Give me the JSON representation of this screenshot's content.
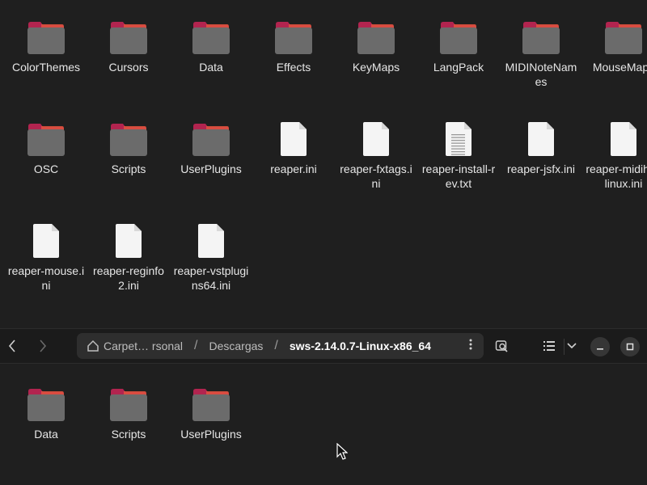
{
  "top_items": [
    {
      "type": "folder",
      "label": "ColorThemes"
    },
    {
      "type": "folder",
      "label": "Cursors"
    },
    {
      "type": "folder",
      "label": "Data"
    },
    {
      "type": "folder",
      "label": "Effects"
    },
    {
      "type": "folder",
      "label": "KeyMaps"
    },
    {
      "type": "folder",
      "label": "LangPack"
    },
    {
      "type": "folder",
      "label": "MIDINoteNames"
    },
    {
      "type": "folder",
      "label": "MouseMaps"
    },
    {
      "type": "folder",
      "label": "OSC"
    },
    {
      "type": "folder",
      "label": "Scripts"
    },
    {
      "type": "folder",
      "label": "UserPlugins"
    },
    {
      "type": "file",
      "label": "reaper.ini"
    },
    {
      "type": "file",
      "label": "reaper-fxtags.ini"
    },
    {
      "type": "text-file",
      "label": "reaper-install-rev.txt"
    },
    {
      "type": "file",
      "label": "reaper-jsfx.ini"
    },
    {
      "type": "file",
      "label": "reaper-midihw-linux.ini"
    },
    {
      "type": "file",
      "label": "reaper-mouse.ini"
    },
    {
      "type": "file",
      "label": "reaper-reginfo2.ini"
    },
    {
      "type": "file",
      "label": "reaper-vstplugins64.ini"
    }
  ],
  "header": {
    "back_icon": "chevron-left-icon",
    "forward_icon": "chevron-right-icon",
    "path": {
      "home_icon": "home-icon",
      "crumb_1": "Carpet… rsonal",
      "crumb_2": "Descargas",
      "crumb_3": "sws-2.14.0.7-Linux-x86_64",
      "separator": "/",
      "menu_icon": "vertical-dots-icon"
    },
    "search_icon": "search-icon",
    "view_icon": "list-view-icon",
    "view_dropdown_icon": "chevron-down-icon",
    "minimize_icon": "minimize-icon",
    "maximize_icon": "maximize-icon"
  },
  "bottom_items": [
    {
      "type": "folder",
      "label": "Data"
    },
    {
      "type": "folder",
      "label": "Scripts"
    },
    {
      "type": "folder",
      "label": "UserPlugins"
    }
  ],
  "colors": {
    "folder_body": "#6b6b6b",
    "folder_tab": "#b2244f",
    "folder_accent": "#e0533e",
    "background": "#1f1f1f"
  }
}
